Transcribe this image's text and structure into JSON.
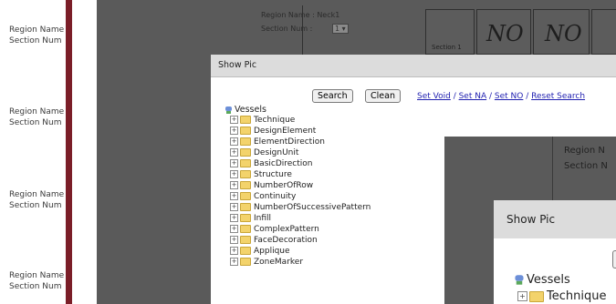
{
  "left_panel": {
    "labels": [
      {
        "region": "Region Name",
        "section": "Section Num"
      },
      {
        "region": "Region Name",
        "section": "Section Num"
      },
      {
        "region": "Region Name",
        "section": "Section Num"
      },
      {
        "region": "Region Name",
        "section": "Section Num"
      }
    ]
  },
  "background_page": {
    "region_label": "Region Name : Neck1",
    "section_label": "Section Num :",
    "section_value": "1",
    "section_caption": "Section 1",
    "no_marks": [
      "NO",
      "NO"
    ]
  },
  "dialog": {
    "title": "Show Pic",
    "search_label": "Search",
    "clean_label": "Clean",
    "links": [
      "Set Void",
      "Set NA",
      "Set NO",
      "Reset Search"
    ],
    "tree": {
      "root": "Vessels",
      "items": [
        "Technique",
        "DesignElement",
        "ElementDirection",
        "DesignUnit",
        "BasicDirection",
        "Structure",
        "NumberOfRow",
        "Continuity",
        "NumberOfSuccessivePattern",
        "Infill",
        "ComplexPattern",
        "FaceDecoration",
        "Applique",
        "ZoneMarker"
      ]
    }
  },
  "nested_overlay": {
    "region_text": "Region N",
    "section_text": "Section N"
  },
  "nested_dialog": {
    "title": "Show Pic",
    "root": "Vessels",
    "first_item": "Technique"
  },
  "colors": {
    "accent_bar": "#7b1e28",
    "overlay": "#5a5a5a",
    "link": "#1f1fb0",
    "folder": "#f3d36b"
  }
}
